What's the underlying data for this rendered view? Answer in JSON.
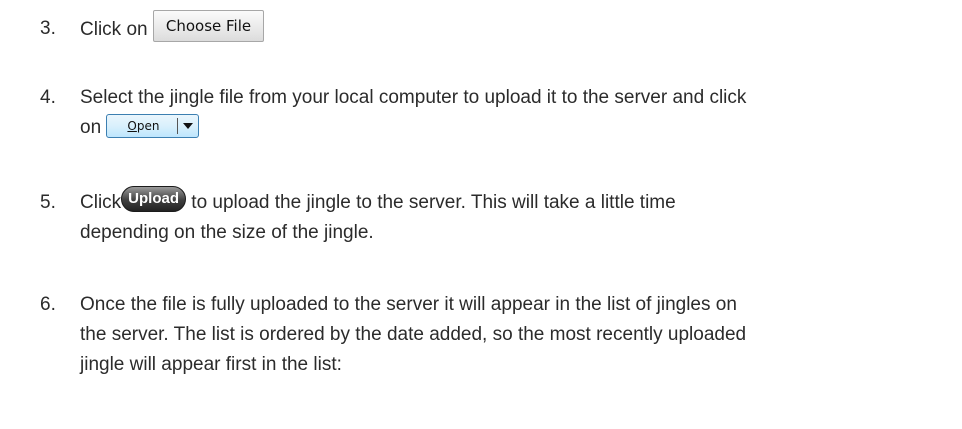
{
  "steps": [
    {
      "number": "3.",
      "text_before": "Click on",
      "button": "Choose File"
    },
    {
      "number": "4.",
      "line1": "Select the jingle file from your local computer to upload it to the server and click",
      "line2_before": "on",
      "button": "Open"
    },
    {
      "number": "5.",
      "text_before": "Click",
      "button": "Upload",
      "text_after": "to upload the jingle to the server. This will take a little time",
      "line2": "depending on the size of the jingle."
    },
    {
      "number": "6.",
      "line1": "Once the file is fully uploaded to the server it will appear in the list of jingles on",
      "line2": "the server. The list is ordered by the date added, so the most recently uploaded",
      "line3": "jingle will appear first in the list:"
    }
  ]
}
